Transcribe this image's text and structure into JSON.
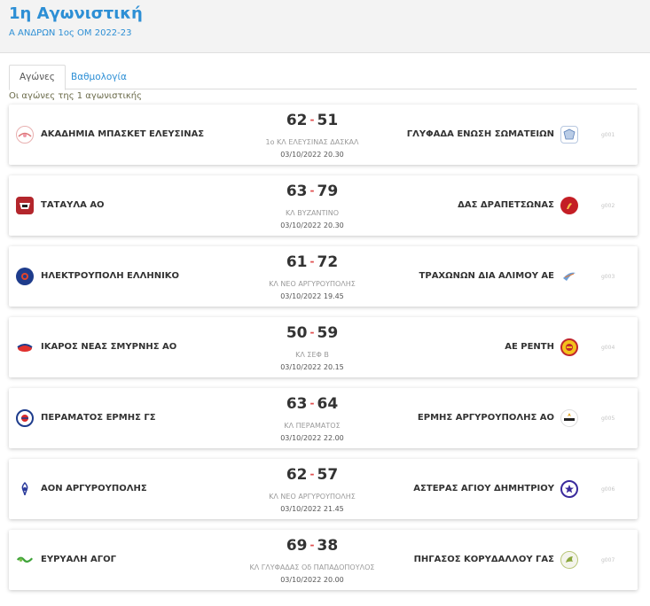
{
  "header": {
    "title": "1η Αγωνιστική",
    "subtitle": "Α ΑΝΔΡΩΝ 1ος ΟΜ 2022-23"
  },
  "tabs": [
    {
      "label": "Αγώνες",
      "active": true
    },
    {
      "label": "Βαθμολογία",
      "active": false
    }
  ],
  "round_info": "Οι αγώνες της 1 αγωνιστικής",
  "colors": {
    "accent": "#2d8fd5",
    "score_separator": "#e05050"
  },
  "games": [
    {
      "home": "ΑΚΑΔΗΜΙΑ ΜΠΑΣΚΕΤ ΕΛΕΥΣΙΝΑΣ",
      "home_score": "62",
      "away": "ΓΛΥΦΑΔΑ ΕΝΩΣΗ ΣΩΜΑΤΕΙΩΝ",
      "away_score": "51",
      "venue": "1ο ΚΛ ΕΛΕΥΣΙΝΑΣ ΔΑΣΚΑΛ",
      "datetime": "03/10/2022 20.30",
      "code": "g001",
      "home_logo": "akadimia-eleusinas-logo",
      "away_logo": "glyfada-logo"
    },
    {
      "home": "ΤΑΤΑΥΛΑ ΑΟ",
      "home_score": "63",
      "away": "ΔΑΣ ΔΡΑΠΕΤΣΩΝΑΣ",
      "away_score": "79",
      "venue": "ΚΛ ΒΥΖΑΝΤΙΝΟ",
      "datetime": "03/10/2022 20.30",
      "code": "g002",
      "home_logo": "tataula-logo",
      "away_logo": "das-drapetsonas-logo"
    },
    {
      "home": "ΗΛΕΚΤΡΟΥΠΟΛΗ ΕΛΛΗΝΙΚΟ",
      "home_score": "61",
      "away": "ΤΡΑΧΩΝΩΝ ΔΙΑ ΑΛΙΜΟΥ ΑΕ",
      "away_score": "72",
      "venue": "ΚΛ ΝΕΟ ΑΡΓΥΡΟΥΠΟΛΗΣ",
      "datetime": "03/10/2022 19.45",
      "code": "g003",
      "home_logo": "ilektroupoli-logo",
      "away_logo": "trachones-logo"
    },
    {
      "home": "ΙΚΑΡΟΣ ΝΕΑΣ ΣΜΥΡΝΗΣ ΑΟ",
      "home_score": "50",
      "away": "ΑΕ ΡΕΝΤΗ",
      "away_score": "59",
      "venue": "ΚΛ ΣΕΦ Β",
      "datetime": "03/10/2022 20.15",
      "code": "g004",
      "home_logo": "ikaros-logo",
      "away_logo": "ae-renti-logo"
    },
    {
      "home": "ΠΕΡΑΜΑΤΟΣ ΕΡΜΗΣ ΓΣ",
      "home_score": "63",
      "away": "ΕΡΜΗΣ ΑΡΓΥΡΟΥΠΟΛΗΣ ΑΟ",
      "away_score": "64",
      "venue": "ΚΛ ΠΕΡΑΜΑΤΟΣ",
      "datetime": "03/10/2022 22.00",
      "code": "g005",
      "home_logo": "peramatos-ermis-logo",
      "away_logo": "ermis-argyroupolis-logo"
    },
    {
      "home": "ΑΟΝ ΑΡΓΥΡΟΥΠΟΛΗΣ",
      "home_score": "62",
      "away": "ΑΣΤΕΡΑΣ ΑΓΙΟΥ ΔΗΜΗΤΡΙΟΥ",
      "away_score": "57",
      "venue": "ΚΛ ΝΕΟ ΑΡΓΥΡΟΥΠΟΛΗΣ",
      "datetime": "03/10/2022 21.45",
      "code": "g006",
      "home_logo": "aon-argyroupolis-logo",
      "away_logo": "asteras-agiou-dimitriou-logo"
    },
    {
      "home": "ΕΥΡΥΑΛΗ ΑΓΟΓ",
      "home_score": "69",
      "away": "ΠΗΓΑΣΟΣ ΚΟΡΥΔΑΛΛΟΥ ΓΑΣ",
      "away_score": "38",
      "venue": "ΚΛ ΓΛΥΦΑΔΑΣ Οδ ΠΑΠΑΔΟΠΟΥΛΟΣ",
      "datetime": "03/10/2022 20.00",
      "code": "g007",
      "home_logo": "evryali-logo",
      "away_logo": "pigasos-korydallou-logo"
    }
  ]
}
